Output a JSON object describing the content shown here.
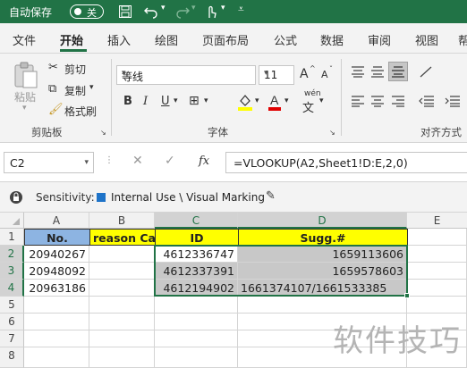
{
  "titlebar": {
    "autosave": "自动保存",
    "toggle": "关"
  },
  "tabs": [
    "文件",
    "开始",
    "插入",
    "绘图",
    "页面布局",
    "公式",
    "数据",
    "审阅",
    "视图",
    "帮"
  ],
  "clipboard": {
    "paste": "粘贴",
    "cut": "剪切",
    "copy": "复制",
    "format_painter": "格式刷",
    "group": "剪贴板"
  },
  "font": {
    "name": "等线",
    "size": "11",
    "bold": "B",
    "italic": "I",
    "underline": "U",
    "grow": "A",
    "shrink": "A",
    "pinyin": "wén",
    "group": "字体"
  },
  "alignment": {
    "group": "对齐方式"
  },
  "formula_bar": {
    "cell_ref": "C2",
    "formula": "=VLOOKUP(A2,Sheet1!D:E,2,0)",
    "fx": "fx"
  },
  "sensitivity": {
    "label": "Sensitivity:",
    "value": "Internal Use \\ Visual Marking"
  },
  "columns": [
    "A",
    "B",
    "C",
    "D",
    "E"
  ],
  "rows": [
    "1",
    "2",
    "3",
    "4",
    "5",
    "6",
    "7",
    "8"
  ],
  "sheet": {
    "header": [
      "No.",
      "reason Ca",
      "ID",
      "Sugg.#"
    ],
    "data": [
      [
        "20940267",
        "",
        "4612336747",
        "1659113606"
      ],
      [
        "20948092",
        "",
        "4612337391",
        "1659578603"
      ],
      [
        "20963186",
        "",
        "4612194902",
        "1661374107/1661533385"
      ]
    ]
  },
  "watermark": "软件技巧"
}
